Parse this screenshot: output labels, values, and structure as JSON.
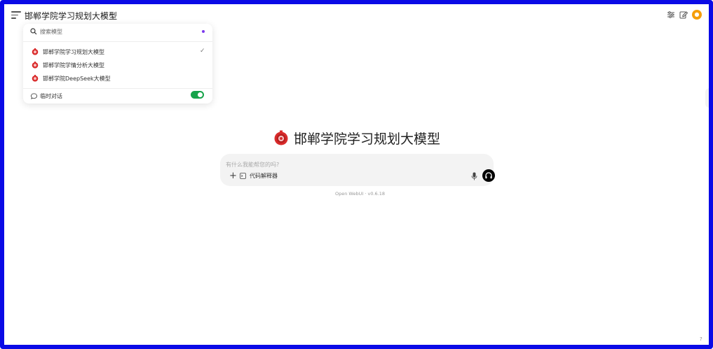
{
  "header": {
    "model_name": "邯郸学院学习规划大模型",
    "new_label": "+"
  },
  "dropdown": {
    "search_placeholder": "搜索模型",
    "models": [
      {
        "label": "邯郸学院学习规划大模型",
        "selected": true
      },
      {
        "label": "邯郸学院学情分析大模型",
        "selected": false
      },
      {
        "label": "邯郸学院DeepSeek大模型",
        "selected": false
      }
    ],
    "check_mark": "✓",
    "temp_chat_label": "临时对话",
    "temp_chat_enabled": true
  },
  "hero": {
    "title": "邯郸学院学习规划大模型"
  },
  "composer": {
    "placeholder": "有什么我能帮您的吗?",
    "plus_label": "+",
    "code_interpreter_label": "代码解释器"
  },
  "footer": {
    "version": "Open WebUI · v0.6.18",
    "help": "?"
  },
  "colors": {
    "frame": "#0a0ae6",
    "toggle_on": "#16a34a",
    "avatar": "#f59e0b",
    "accent_dot": "#7c3aed",
    "logo_red": "#d92b2b"
  }
}
